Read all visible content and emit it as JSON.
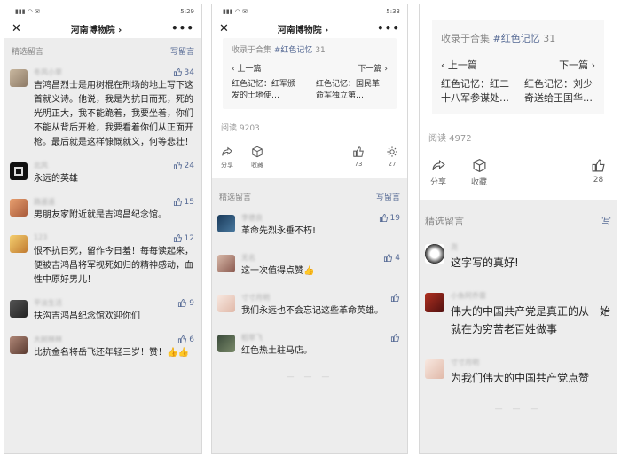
{
  "p1": {
    "status": {
      "time": "5:29"
    },
    "title": "河南博物院 ›",
    "section_title": "精选留言",
    "write": "写留言",
    "comments": [
      {
        "name": "冬风小草",
        "text": "吉鸿昌烈士是用树棍在刑场的地上写下这首就义诗。他说，我是为抗日而死，死的光明正大，我不能跪着，我要坐着，你们不能从背后开枪，我要看着你们从正面开枪。最后就是这样慷慨就义，何等悲壮！",
        "likes": "34"
      },
      {
        "name": "北风",
        "text": "永远的英雄",
        "likes": "24"
      },
      {
        "name": "路遥遥",
        "text": "男朋友家附近就是吉鸿昌纪念馆。",
        "likes": "15"
      },
      {
        "name": "123",
        "text": "恨不抗日死，留作今日羞！每每读起来，便被吉鸿昌将军视死如归的精神感动，血性中原好男儿！",
        "likes": "12"
      },
      {
        "name": "平淡生活",
        "text": "扶沟吉鸿昌纪念馆欢迎你们",
        "likes": "9"
      },
      {
        "name": "大树林林",
        "text": "比抗金名将岳飞还年轻三岁！赞！👍👍",
        "likes": "6"
      }
    ]
  },
  "p2": {
    "status": {
      "time": "5:33"
    },
    "title": "河南博物院 ›",
    "collection": {
      "prefix": "收录于合集",
      "tag": "#红色记忆",
      "count": "31"
    },
    "prev": {
      "label": "‹ 上一篇",
      "text": "红色记忆：红军颁发的土地使…"
    },
    "next": {
      "label": "下一篇 ›",
      "text": "红色记忆：国民革命军独立第…"
    },
    "read": "阅读 9203",
    "actions": {
      "share": "分享",
      "fav": "收藏",
      "like": "73",
      "watch": "27"
    },
    "section_title": "精选留言",
    "write": "写留言",
    "comments": [
      {
        "name": "李德良",
        "text": "革命先烈永垂不朽!",
        "likes": "19"
      },
      {
        "name": "无名",
        "text": "这一次值得点赞👍",
        "likes": "4"
      },
      {
        "name": "寸寸月明",
        "text": "我们永远也不会忘记这些革命英雄。",
        "likes": ""
      },
      {
        "name": "稻草飞",
        "text": "红色热土驻马店。",
        "likes": ""
      }
    ],
    "dots": "— — —"
  },
  "p3": {
    "collection": {
      "prefix": "收录于合集",
      "tag": "#红色记忆",
      "count": "31"
    },
    "prev": {
      "label": "‹ 上一篇",
      "text": "红色记忆：红二十八军参谋处…"
    },
    "next": {
      "label": "下一篇 ›",
      "text": "红色记忆：刘少奇送给王国华…"
    },
    "read": "阅读 4972",
    "actions": {
      "share": "分享",
      "fav": "收藏",
      "like": "28"
    },
    "section_title": "精选留言",
    "write": "写",
    "comments": [
      {
        "name": "尧",
        "text": "这字写的真好!"
      },
      {
        "name": "小鱼阿乔蓉",
        "text": "伟大的中国共产党是真正的从一始就在为穷苦老百姓做事"
      },
      {
        "name": "寸寸月明",
        "text": "为我们伟大的中国共产党点赞"
      }
    ],
    "dots": "— — —"
  }
}
